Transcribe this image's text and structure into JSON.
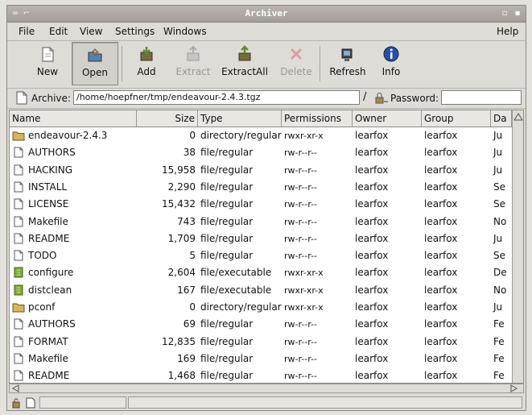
{
  "window": {
    "title": "Archiver"
  },
  "menu": [
    "File",
    "Edit",
    "View",
    "Settings",
    "Windows"
  ],
  "help": "Help",
  "toolbar": [
    {
      "label": "New",
      "icon": "new-icon",
      "enabled": true,
      "pressed": false
    },
    {
      "label": "Open",
      "icon": "open-icon",
      "enabled": true,
      "pressed": true
    },
    {
      "label": "Add",
      "icon": "add-icon",
      "enabled": true,
      "pressed": false
    },
    {
      "label": "Extract",
      "icon": "extract-icon",
      "enabled": false,
      "pressed": false
    },
    {
      "label": "ExtractAll",
      "icon": "extract-all-icon",
      "enabled": true,
      "pressed": false
    },
    {
      "label": "Delete",
      "icon": "delete-icon",
      "enabled": false,
      "pressed": false
    },
    {
      "label": "Refresh",
      "icon": "refresh-icon",
      "enabled": true,
      "pressed": false
    },
    {
      "label": "Info",
      "icon": "info-icon",
      "enabled": true,
      "pressed": false
    }
  ],
  "pathbar": {
    "archive_label": "Archive:",
    "archive_value": "/home/hoepfner/tmp/endeavour-2.4.3.tgz",
    "password_label": "Password:",
    "password_value": ""
  },
  "columns": [
    "Name",
    "Size",
    "Type",
    "Permissions",
    "Owner",
    "Group",
    "Da"
  ],
  "rows": [
    {
      "icon": "folder",
      "name": "endeavour-2.4.3",
      "size": "0",
      "type": "directory/regular",
      "perm": "rwxr-xr-x",
      "owner": "learfox",
      "group": "learfox",
      "date": "Ju"
    },
    {
      "icon": "file",
      "name": "AUTHORS",
      "size": "38",
      "type": "file/regular",
      "perm": "rw-r--r--",
      "owner": "learfox",
      "group": "learfox",
      "date": "Ju"
    },
    {
      "icon": "file",
      "name": "HACKING",
      "size": "15,958",
      "type": "file/regular",
      "perm": "rw-r--r--",
      "owner": "learfox",
      "group": "learfox",
      "date": "Ju"
    },
    {
      "icon": "file",
      "name": "INSTALL",
      "size": "2,290",
      "type": "file/regular",
      "perm": "rw-r--r--",
      "owner": "learfox",
      "group": "learfox",
      "date": "Se"
    },
    {
      "icon": "file",
      "name": "LICENSE",
      "size": "15,432",
      "type": "file/regular",
      "perm": "rw-r--r--",
      "owner": "learfox",
      "group": "learfox",
      "date": "Se"
    },
    {
      "icon": "file",
      "name": "Makefile",
      "size": "743",
      "type": "file/regular",
      "perm": "rw-r--r--",
      "owner": "learfox",
      "group": "learfox",
      "date": "No"
    },
    {
      "icon": "file",
      "name": "README",
      "size": "1,709",
      "type": "file/regular",
      "perm": "rw-r--r--",
      "owner": "learfox",
      "group": "learfox",
      "date": "Ju"
    },
    {
      "icon": "file",
      "name": "TODO",
      "size": "5",
      "type": "file/regular",
      "perm": "rw-r--r--",
      "owner": "learfox",
      "group": "learfox",
      "date": "Se"
    },
    {
      "icon": "exec",
      "name": "configure",
      "size": "2,604",
      "type": "file/executable",
      "perm": "rwxr-xr-x",
      "owner": "learfox",
      "group": "learfox",
      "date": "De"
    },
    {
      "icon": "exec",
      "name": "distclean",
      "size": "167",
      "type": "file/executable",
      "perm": "rwxr-xr-x",
      "owner": "learfox",
      "group": "learfox",
      "date": "No"
    },
    {
      "icon": "folder",
      "name": "pconf",
      "size": "0",
      "type": "directory/regular",
      "perm": "rwxr-xr-x",
      "owner": "learfox",
      "group": "learfox",
      "date": "Ju"
    },
    {
      "icon": "file",
      "name": "AUTHORS",
      "size": "69",
      "type": "file/regular",
      "perm": "rw-r--r--",
      "owner": "learfox",
      "group": "learfox",
      "date": "Fe"
    },
    {
      "icon": "file",
      "name": "FORMAT",
      "size": "12,835",
      "type": "file/regular",
      "perm": "rw-r--r--",
      "owner": "learfox",
      "group": "learfox",
      "date": "Fe"
    },
    {
      "icon": "file",
      "name": "Makefile",
      "size": "169",
      "type": "file/regular",
      "perm": "rw-r--r--",
      "owner": "learfox",
      "group": "learfox",
      "date": "Fe"
    },
    {
      "icon": "file",
      "name": "README",
      "size": "1,468",
      "type": "file/regular",
      "perm": "rw-r--r--",
      "owner": "learfox",
      "group": "learfox",
      "date": "Fe"
    }
  ],
  "colors": {
    "folder": "#d9b45a",
    "exec": "#7fae3c",
    "info": "#2a4fa8",
    "add": "#5b8f2e"
  }
}
